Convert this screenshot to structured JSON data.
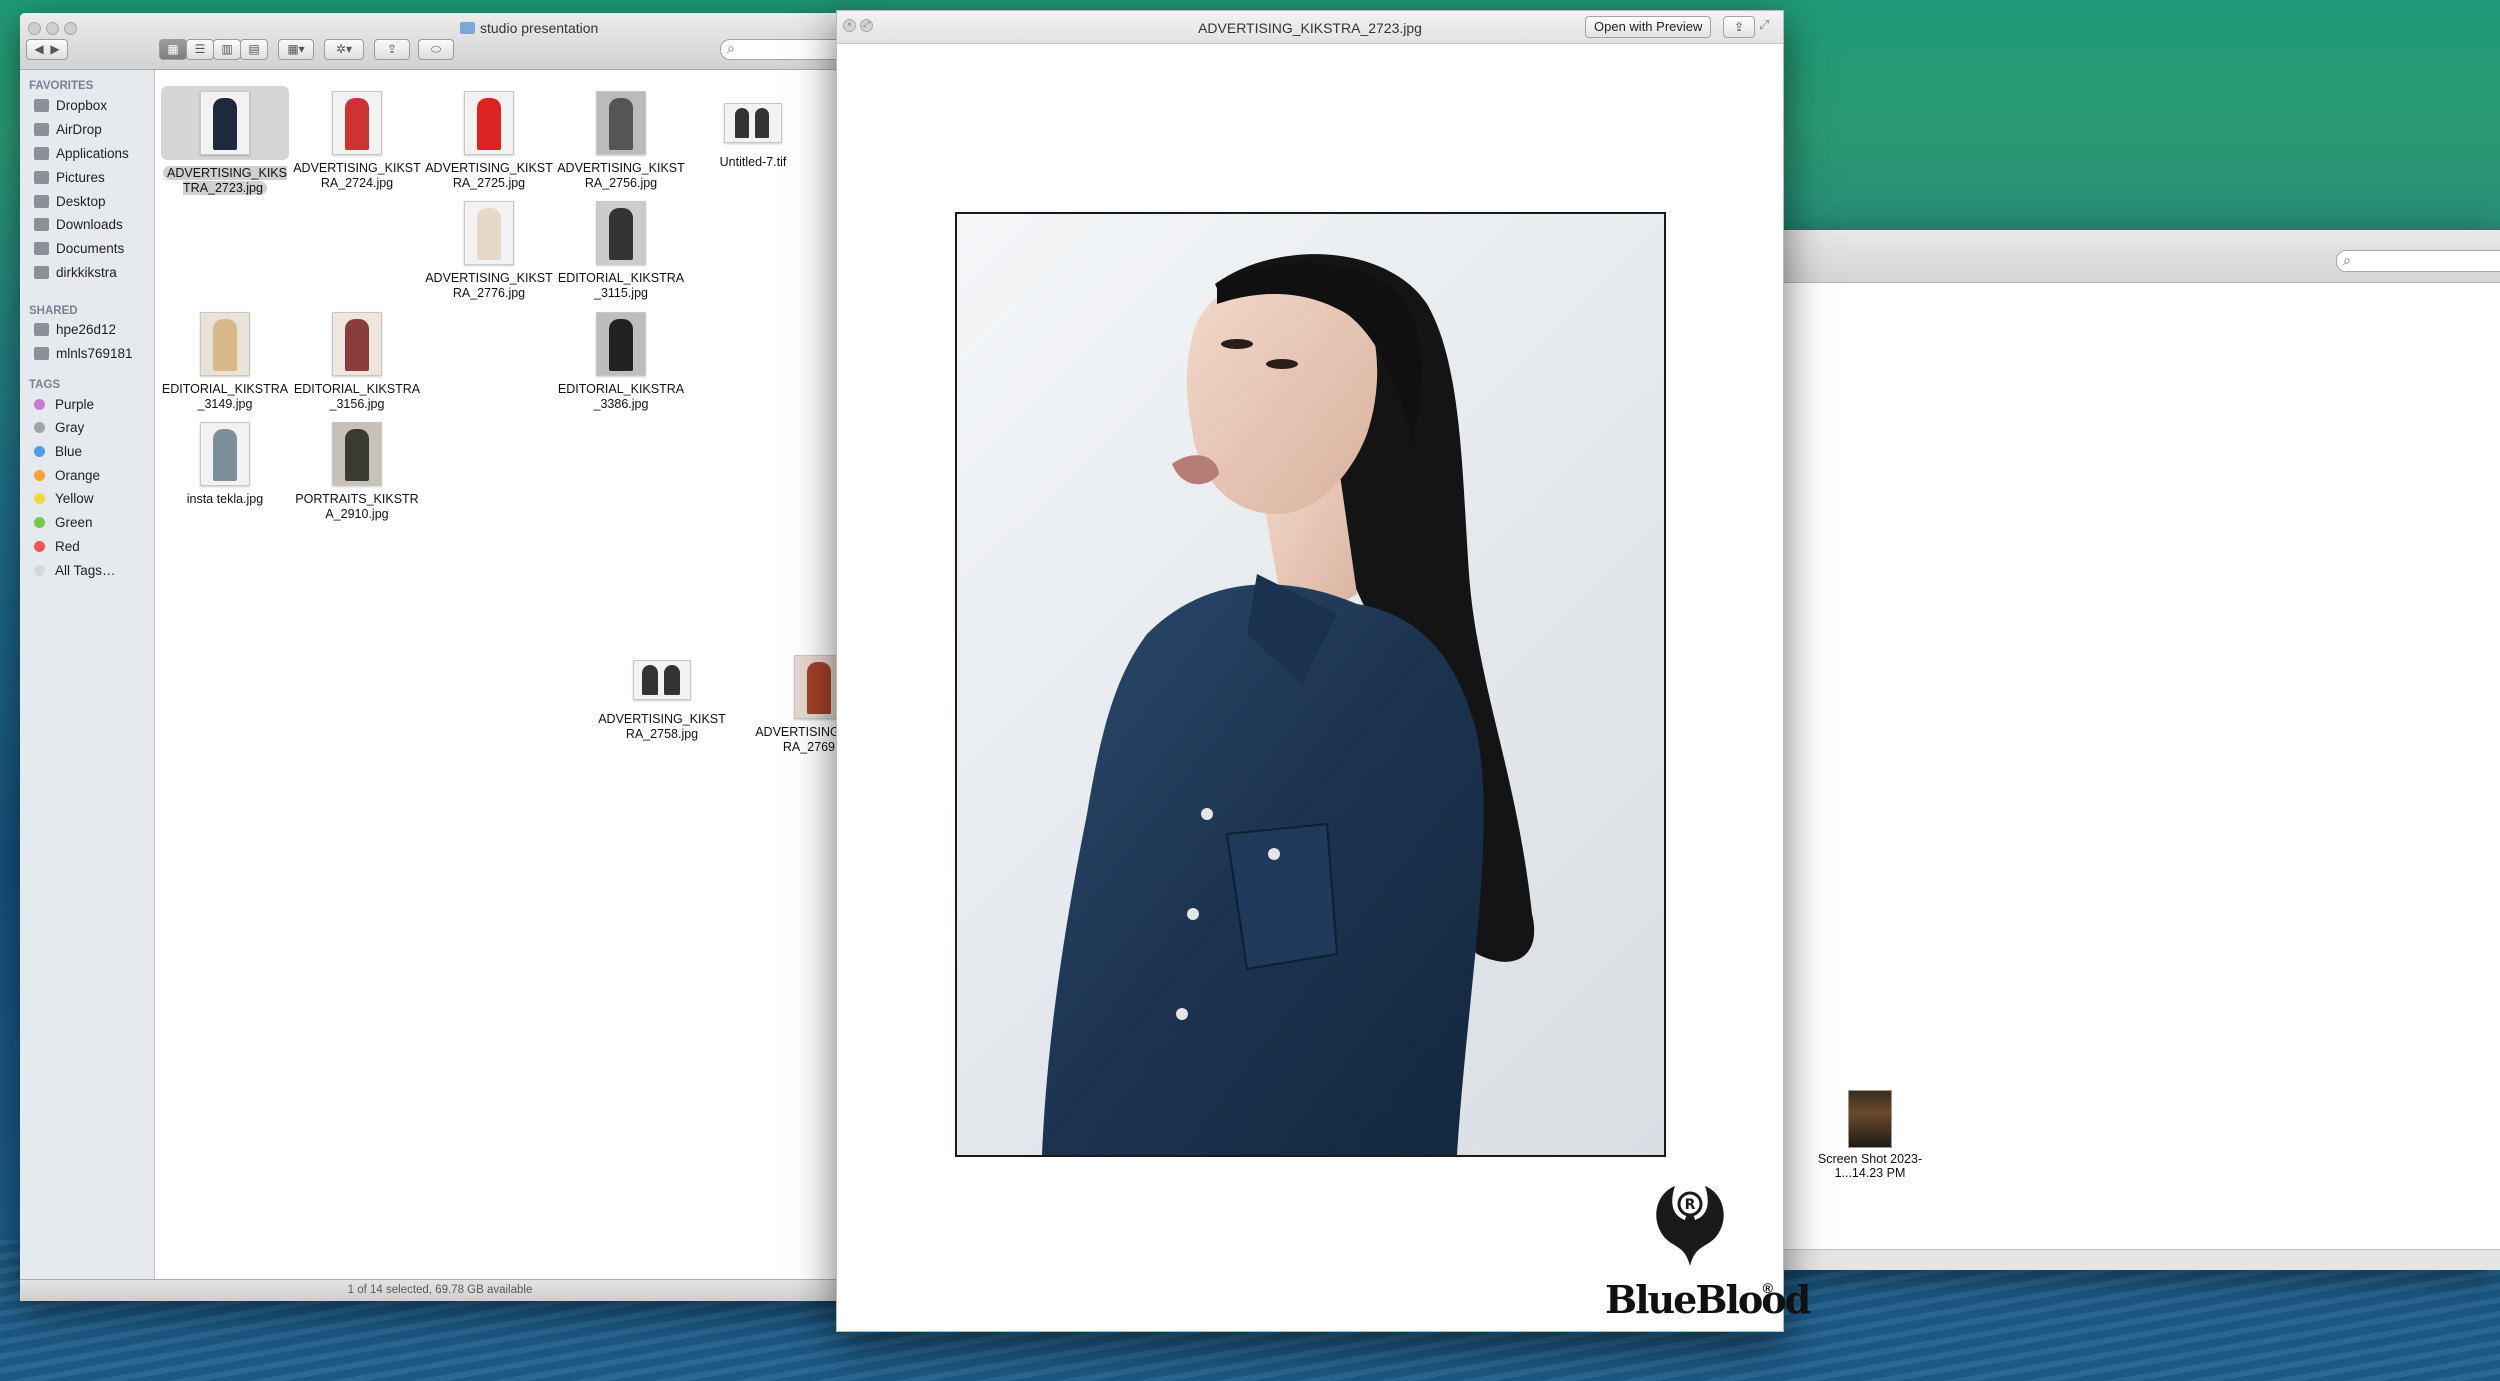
{
  "finder": {
    "window_title": "studio presentation",
    "search_placeholder": "",
    "status": "1 of 14 selected, 69.78 GB available",
    "sidebar": {
      "favorites_header": "FAVORITES",
      "favorites": [
        {
          "label": "Dropbox",
          "icon": "dropbox-icon"
        },
        {
          "label": "AirDrop",
          "icon": "airdrop-icon"
        },
        {
          "label": "Applications",
          "icon": "applications-icon"
        },
        {
          "label": "Pictures",
          "icon": "pictures-icon"
        },
        {
          "label": "Desktop",
          "icon": "desktop-icon"
        },
        {
          "label": "Downloads",
          "icon": "downloads-icon"
        },
        {
          "label": "Documents",
          "icon": "documents-icon"
        },
        {
          "label": "dirkkikstra",
          "icon": "home-icon"
        }
      ],
      "shared_header": "SHARED",
      "shared": [
        {
          "label": "hpe26d12",
          "icon": "computer-icon"
        },
        {
          "label": "mlnls769181",
          "icon": "computer-icon"
        }
      ],
      "tags_header": "TAGS",
      "tags": [
        {
          "label": "Purple",
          "color": "#c97bd9"
        },
        {
          "label": "Gray",
          "color": "#a4a4a4"
        },
        {
          "label": "Blue",
          "color": "#4f9ee8"
        },
        {
          "label": "Orange",
          "color": "#f3a33a"
        },
        {
          "label": "Yellow",
          "color": "#f0d93a"
        },
        {
          "label": "Green",
          "color": "#77c94a"
        },
        {
          "label": "Red",
          "color": "#ef5656"
        },
        {
          "label": "All Tags…",
          "color": "#d8d8d8"
        }
      ]
    },
    "files": [
      {
        "name": "ADVERTISING_KIKSTRA_2723.jpg",
        "selected": true
      },
      {
        "name": "ADVERTISING_KIKSTRA_2724.jpg"
      },
      {
        "name": "ADVERTISING_KIKSTRA_2725.jpg"
      },
      {
        "name": "ADVERTISING_KIKSTRA_2756.jpg"
      },
      {
        "name": "Untitled-7.tif"
      },
      {
        "name": "ADVERTISING_KIKSTRA_2776.jpg"
      },
      {
        "name": "EDITORIAL_KIKSTRA_3115.jpg"
      },
      {
        "name": "EDITORIAL_KIKSTRA_3149.jpg"
      },
      {
        "name": "EDITORIAL_KIKSTRA_3156.jpg"
      },
      {
        "name": "EDITORIAL_KIKSTRA_3386.jpg"
      },
      {
        "name": "insta tekla.jpg"
      },
      {
        "name": "PORTRAITS_KIKSTRA_2910.jpg"
      },
      {
        "name": "ADVERTISING_KIKSTRA_2758.jpg"
      },
      {
        "name": "ADVERTISING_KIKSTRA_2769.jpg"
      }
    ]
  },
  "quicklook": {
    "title": "ADVERTISING_KIKSTRA_2723.jpg",
    "open_with_label": "Open with Preview",
    "logo_text": "BlueBlood",
    "logo_mark": "®"
  },
  "desktop": {
    "file_label": "Screen Shot 2023-1...14.23 PM"
  }
}
